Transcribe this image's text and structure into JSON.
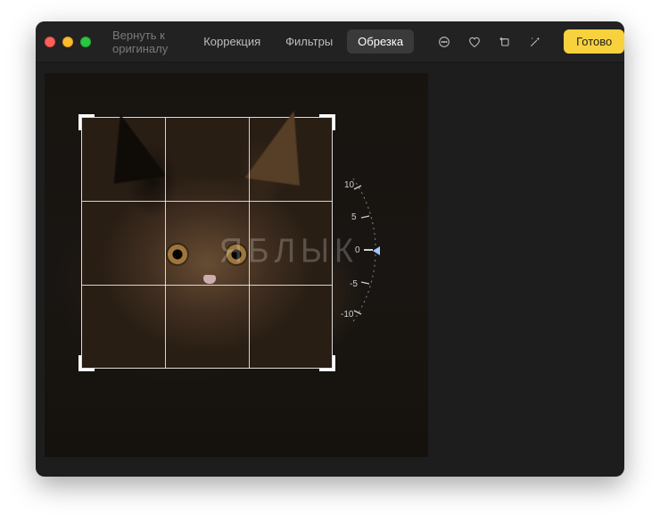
{
  "toolbar": {
    "revert_label": "Вернуть к оригиналу",
    "tabs": [
      {
        "label": "Коррекция",
        "active": false
      },
      {
        "label": "Фильтры",
        "active": false
      },
      {
        "label": "Обрезка",
        "active": true
      }
    ],
    "done_label": "Готово"
  },
  "dial": {
    "value": 0,
    "ticks": [
      "10",
      "5",
      "0",
      "-5",
      "-10"
    ]
  },
  "watermark": "ЯБЛЫК",
  "colors": {
    "accent": "#f8d23c"
  }
}
